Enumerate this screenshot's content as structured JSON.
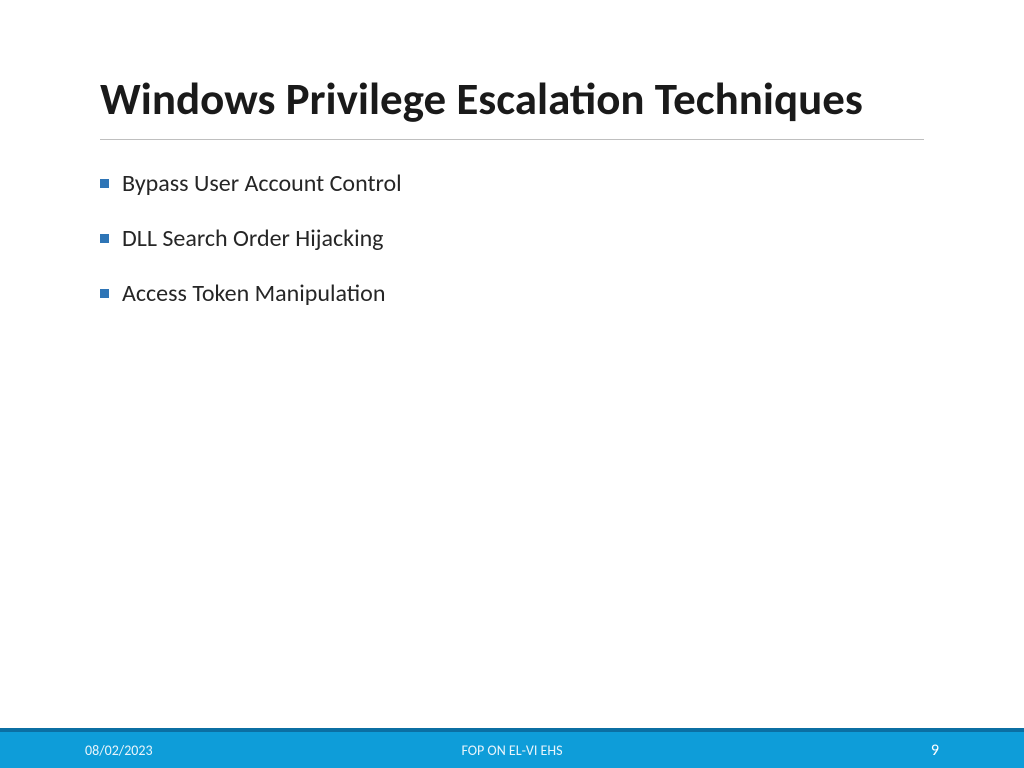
{
  "slide": {
    "title": "Windows Privilege Escalation Techniques",
    "bullets": [
      "Bypass User Account Control",
      "DLL Search Order Hijacking",
      "Access Token Manipulation"
    ]
  },
  "footer": {
    "date": "08/02/2023",
    "center": "FOP ON EL-VI EHS",
    "page": "9"
  }
}
